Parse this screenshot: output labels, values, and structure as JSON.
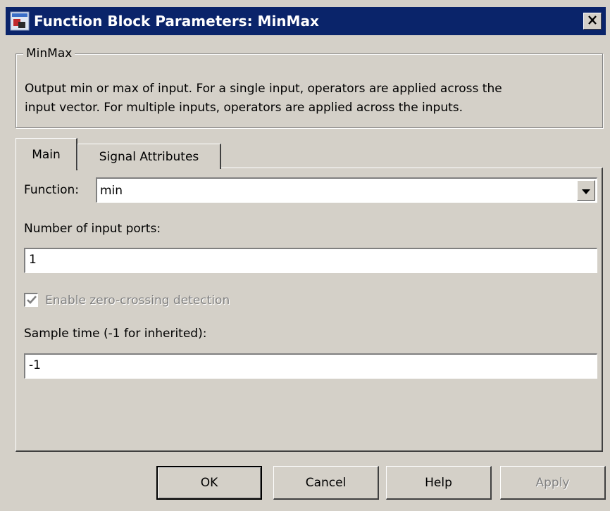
{
  "window": {
    "title": "Function Block Parameters: MinMax",
    "icon": "simulink-block-icon",
    "close_icon": "close-icon"
  },
  "group": {
    "legend": "MinMax",
    "description_line1": "Output min or max of input.  For a single input, operators are applied across the",
    "description_line2": "input vector.  For multiple inputs, operators are applied across the inputs."
  },
  "tabs": [
    {
      "label": "Main",
      "active": true
    },
    {
      "label": "Signal Attributes",
      "active": false
    }
  ],
  "main": {
    "function_label": "Function:",
    "function_value": "min",
    "ports_label": "Number of input ports:",
    "ports_value": "1",
    "zero_crossing_label": "Enable zero-crossing detection",
    "zero_crossing_checked": true,
    "zero_crossing_enabled": false,
    "sample_time_label": "Sample time (-1 for inherited):",
    "sample_time_value": "-1"
  },
  "buttons": {
    "ok": "OK",
    "cancel": "Cancel",
    "help": "Help",
    "apply": "Apply"
  },
  "colors": {
    "titlebar": "#0a246a",
    "face": "#d4d0c8",
    "disabled_text": "#808080"
  }
}
